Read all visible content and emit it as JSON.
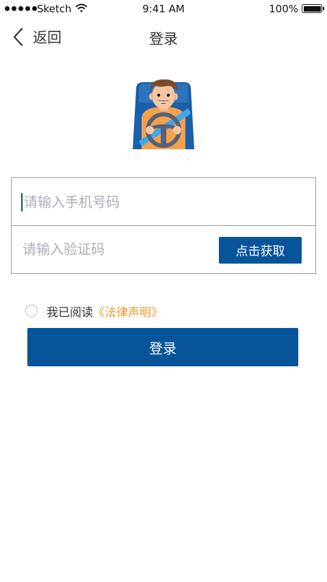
{
  "status_bar": {
    "carrier": "Sketch",
    "time": "9:41 AM",
    "battery": "100%"
  },
  "nav": {
    "back_label": "返回",
    "title": "登录"
  },
  "illustration": {
    "icon": "driver-avatar-icon"
  },
  "form": {
    "phone_placeholder": "请输入手机号码",
    "code_placeholder": "请输入验证码",
    "get_code_label": "点击获取"
  },
  "agreement": {
    "text": "我已阅读",
    "link": "《法律声明》"
  },
  "login_label": "登录",
  "colors": {
    "primary": "#07549a",
    "link": "#f0962e",
    "placeholder": "#a9aebb"
  }
}
